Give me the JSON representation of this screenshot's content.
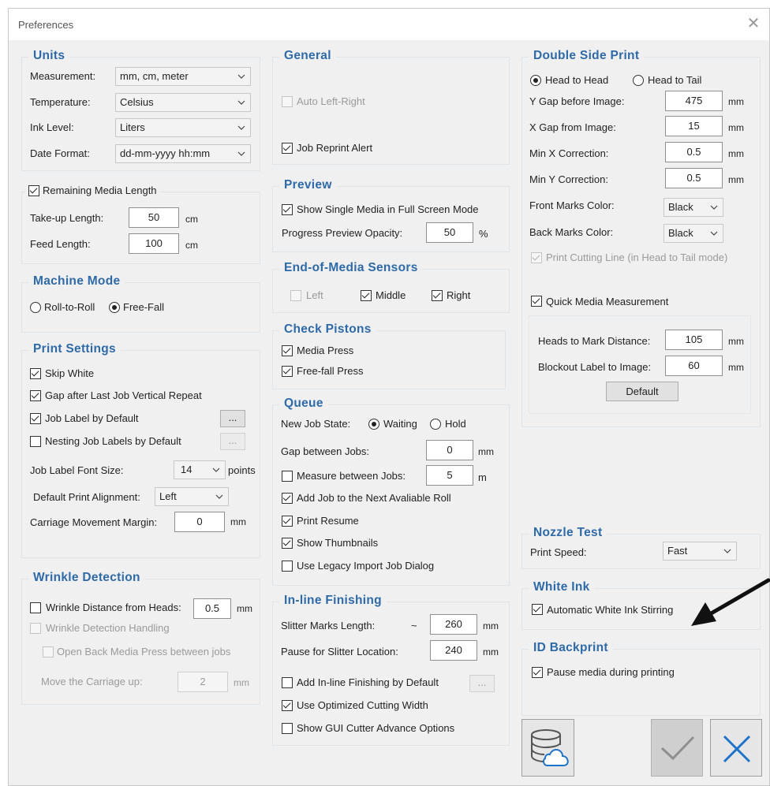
{
  "window": {
    "title": "Preferences",
    "close_glyph": "✕"
  },
  "units": {
    "title": "Units",
    "measurement": {
      "label": "Measurement:",
      "value": "mm, cm, meter"
    },
    "temperature": {
      "label": "Temperature:",
      "value": "Celsius"
    },
    "ink_level": {
      "label": "Ink Level:",
      "value": "Liters"
    },
    "date_format": {
      "label": "Date Format:",
      "value": "dd-mm-yyyy hh:mm"
    }
  },
  "remaining_media": {
    "title": "Remaining Media Length",
    "takeup": {
      "label": "Take-up Length:",
      "value": "50",
      "unit": "cm"
    },
    "feed": {
      "label": "Feed Length:",
      "value": "100",
      "unit": "cm"
    }
  },
  "machine_mode": {
    "title": "Machine Mode",
    "roll": "Roll-to-Roll",
    "freefall": "Free-Fall"
  },
  "print_settings": {
    "title": "Print Settings",
    "skip_white": "Skip White",
    "gap_after": "Gap after Last Job Vertical Repeat",
    "job_label": "Job Label by Default",
    "nesting": "Nesting Job Labels by Default",
    "ellipsis": "...",
    "font_size": {
      "label": "Job Label Font Size:",
      "value": "14",
      "unit": "points"
    },
    "alignment": {
      "label": "Default Print Alignment:",
      "value": "Left"
    },
    "carriage": {
      "label": "Carriage Movement Margin:",
      "value": "0",
      "unit": "mm"
    }
  },
  "wrinkle": {
    "title": "Wrinkle Detection",
    "distance": {
      "label": "Wrinkle Distance from Heads:",
      "value": "0.5",
      "unit": "mm"
    },
    "handling": "Wrinkle Detection Handling",
    "open_back": "Open Back Media Press between jobs",
    "move": {
      "label": "Move the Carriage up:",
      "value": "2",
      "unit": "mm"
    }
  },
  "general": {
    "title": "General",
    "auto_lr": "Auto Left-Right",
    "reprint": "Job Reprint Alert"
  },
  "preview": {
    "title": "Preview",
    "single_media": "Show Single Media in Full Screen Mode",
    "opacity": {
      "label": "Progress Preview Opacity:",
      "value": "50",
      "unit": "%"
    }
  },
  "eom": {
    "title": "End-of-Media Sensors",
    "left": "Left",
    "middle": "Middle",
    "right": "Right"
  },
  "pistons": {
    "title": "Check Pistons",
    "media_press": "Media Press",
    "freefall_press": "Free-fall Press"
  },
  "queue": {
    "title": "Queue",
    "state_label": "New Job State:",
    "waiting": "Waiting",
    "hold": "Hold",
    "gap": {
      "label": "Gap between Jobs:",
      "value": "0",
      "unit": "mm"
    },
    "measure": {
      "label": "Measure between Jobs:",
      "value": "5",
      "unit": "m"
    },
    "add_next": "Add Job to the Next Avaliable Roll",
    "resume": "Print Resume",
    "thumbs": "Show Thumbnails",
    "legacy": "Use Legacy Import Job Dialog"
  },
  "inline": {
    "title": "In-line Finishing",
    "slitter_len": {
      "label": "Slitter Marks Length:",
      "tilde": "~",
      "value": "260",
      "unit": "mm"
    },
    "pause": {
      "label": "Pause for Slitter Location:",
      "value": "240",
      "unit": "mm"
    },
    "add_default": "Add In-line Finishing by Default",
    "ellipsis": "...",
    "optimized": "Use Optimized Cutting Width",
    "gui_cutter": "Show GUI Cutter Advance Options"
  },
  "double_side": {
    "title": "Double Side Print",
    "head_to_head": "Head to Head",
    "head_to_tail": "Head to Tail",
    "y_gap": {
      "label": "Y Gap before Image:",
      "value": "475",
      "unit": "mm"
    },
    "x_gap": {
      "label": "X Gap from Image:",
      "value": "15",
      "unit": "mm"
    },
    "min_x": {
      "label": "Min X Correction:",
      "value": "0.5",
      "unit": "mm"
    },
    "min_y": {
      "label": "Min Y Correction:",
      "value": "0.5",
      "unit": "mm"
    },
    "front_color": {
      "label": "Front Marks Color:",
      "value": "Black"
    },
    "back_color": {
      "label": "Back Marks Color:",
      "value": "Black"
    },
    "cutting_line": "Print Cutting Line (in Head to Tail mode)",
    "quick_measure": "Quick Media Measurement",
    "heads_mark": {
      "label": "Heads to Mark Distance:",
      "value": "105",
      "unit": "mm"
    },
    "blockout": {
      "label": "Blockout Label to Image:",
      "value": "60",
      "unit": "mm"
    },
    "default_btn": "Default"
  },
  "nozzle": {
    "title": "Nozzle Test",
    "label": "Print Speed:",
    "value": "Fast"
  },
  "white_ink": {
    "title": "White Ink",
    "auto_stir": "Automatic White Ink Stirring"
  },
  "id_backprint": {
    "title": "ID Backprint",
    "pause": "Pause media during printing"
  },
  "colors": {
    "section_title": "#2e6aa8",
    "cancel_x": "#1e73c8",
    "ok_check": "#9a9a9a"
  }
}
